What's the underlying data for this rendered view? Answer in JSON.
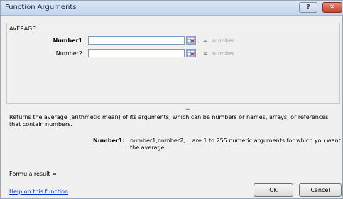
{
  "window": {
    "title": "Function Arguments",
    "help_symbol": "?",
    "close_symbol": "✕"
  },
  "function": {
    "name": "AVERAGE"
  },
  "arguments": [
    {
      "label": "Number1",
      "value": "",
      "equals": "=",
      "result": "number"
    },
    {
      "label": "Number2",
      "value": "",
      "equals": "=",
      "result": "number"
    }
  ],
  "result_equals": "=",
  "description": "Returns the average (arithmetic mean) of its arguments, which can be numbers or names, arrays, or references that contain numbers.",
  "arg_help": {
    "label": "Number1:",
    "text": "number1,number2,... are 1 to 255 numeric arguments for which you want the average."
  },
  "formula_result": "Formula result =",
  "help_link": "Help on this function",
  "buttons": {
    "ok": "OK",
    "cancel": "Cancel"
  }
}
